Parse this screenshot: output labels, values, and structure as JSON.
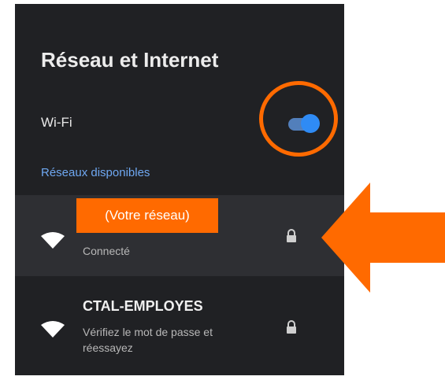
{
  "page": {
    "title": "Réseau et Internet"
  },
  "wifi": {
    "label": "Wi-Fi",
    "toggle_state": "on"
  },
  "section": {
    "available_networks": "Réseaux disponibles"
  },
  "networks": [
    {
      "name": "",
      "status": "Connecté",
      "secured": true,
      "icon": "wifi-icon",
      "selected": true
    },
    {
      "name": "CTAL-EMPLOYES",
      "status": "Vérifiez le mot de passe et réessayez",
      "secured": true,
      "icon": "wifi-icon",
      "selected": false
    }
  ],
  "annotations": {
    "network_label": "(Votre réseau)",
    "highlight_color": "#ff6a00"
  },
  "colors": {
    "panel_bg": "#202124",
    "selected_row_bg": "#2e2f33",
    "accent_blue": "#2f8bf5",
    "section_label": "#6fa8f2"
  }
}
